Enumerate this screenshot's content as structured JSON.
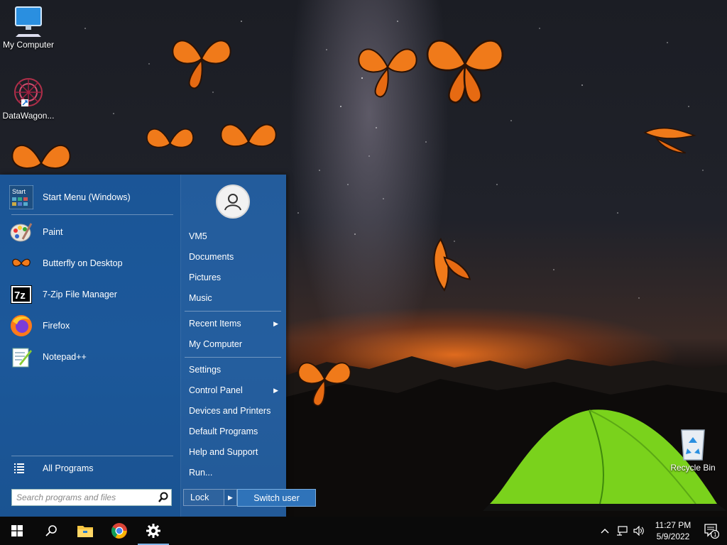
{
  "desktop": {
    "icons": [
      {
        "label": "My Computer"
      },
      {
        "label": "DataWagon..."
      },
      {
        "label": "Recycle Bin"
      }
    ]
  },
  "start_menu": {
    "pinned": [
      {
        "label": "Start Menu (Windows)",
        "icon": "start-menu-icon"
      },
      {
        "label": "Paint",
        "icon": "paint-icon"
      },
      {
        "label": "Butterfly on Desktop",
        "icon": "butterfly-icon"
      },
      {
        "label": "7-Zip File Manager",
        "icon": "7zip-icon"
      },
      {
        "label": "Firefox",
        "icon": "firefox-icon"
      },
      {
        "label": "Notepad++",
        "icon": "notepadpp-icon"
      }
    ],
    "start_icon_text": "Start",
    "zip_icon_text": "7z",
    "all_programs": "All Programs",
    "search_placeholder": "Search programs and files",
    "right_items": [
      {
        "label": "VM5"
      },
      {
        "label": "Documents"
      },
      {
        "label": "Pictures"
      },
      {
        "label": "Music"
      },
      {
        "label": "Recent Items",
        "arrow": "▶"
      },
      {
        "label": "My Computer"
      },
      {
        "label": "Settings"
      },
      {
        "label": "Control Panel",
        "arrow": "▶"
      },
      {
        "label": "Devices and Printers"
      },
      {
        "label": "Default Programs"
      },
      {
        "label": "Help and Support"
      },
      {
        "label": "Run..."
      }
    ],
    "lock_label": "Lock",
    "lock_arrow": "▶",
    "switch_user_label": "Switch user"
  },
  "taskbar": {
    "buttons": [
      {
        "icon": "windows-start-icon"
      },
      {
        "icon": "search-icon"
      },
      {
        "icon": "file-explorer-icon"
      },
      {
        "icon": "chrome-icon"
      },
      {
        "icon": "settings-gear-icon",
        "active": true
      }
    ],
    "tray": {
      "time": "11:27 PM",
      "date": "5/9/2022",
      "notification_count": "1"
    }
  },
  "colors": {
    "start_menu_bg": "#1f5fa3",
    "taskbar_bg": "#0a0a0a",
    "butterfly": "#f07a1a",
    "tent": "#7ad21c"
  }
}
